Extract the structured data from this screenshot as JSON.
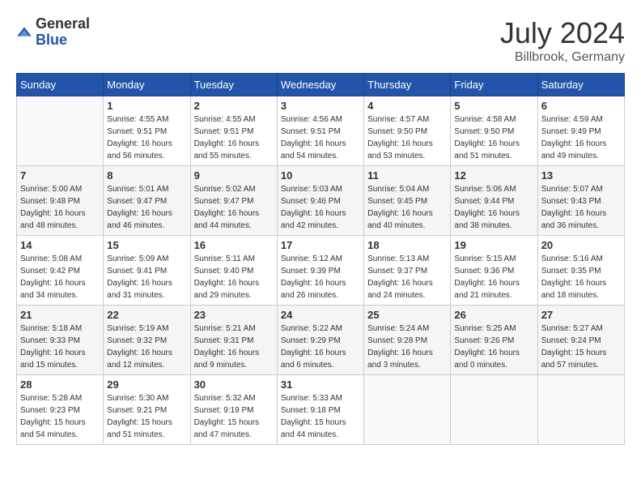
{
  "logo": {
    "general": "General",
    "blue": "Blue"
  },
  "title": "July 2024",
  "subtitle": "Billbrook, Germany",
  "days_of_week": [
    "Sunday",
    "Monday",
    "Tuesday",
    "Wednesday",
    "Thursday",
    "Friday",
    "Saturday"
  ],
  "weeks": [
    [
      {
        "day": "",
        "info": ""
      },
      {
        "day": "1",
        "info": "Sunrise: 4:55 AM\nSunset: 9:51 PM\nDaylight: 16 hours and 56 minutes."
      },
      {
        "day": "2",
        "info": "Sunrise: 4:55 AM\nSunset: 9:51 PM\nDaylight: 16 hours and 55 minutes."
      },
      {
        "day": "3",
        "info": "Sunrise: 4:56 AM\nSunset: 9:51 PM\nDaylight: 16 hours and 54 minutes."
      },
      {
        "day": "4",
        "info": "Sunrise: 4:57 AM\nSunset: 9:50 PM\nDaylight: 16 hours and 53 minutes."
      },
      {
        "day": "5",
        "info": "Sunrise: 4:58 AM\nSunset: 9:50 PM\nDaylight: 16 hours and 51 minutes."
      },
      {
        "day": "6",
        "info": "Sunrise: 4:59 AM\nSunset: 9:49 PM\nDaylight: 16 hours and 49 minutes."
      }
    ],
    [
      {
        "day": "7",
        "info": "Sunrise: 5:00 AM\nSunset: 9:48 PM\nDaylight: 16 hours and 48 minutes."
      },
      {
        "day": "8",
        "info": "Sunrise: 5:01 AM\nSunset: 9:47 PM\nDaylight: 16 hours and 46 minutes."
      },
      {
        "day": "9",
        "info": "Sunrise: 5:02 AM\nSunset: 9:47 PM\nDaylight: 16 hours and 44 minutes."
      },
      {
        "day": "10",
        "info": "Sunrise: 5:03 AM\nSunset: 9:46 PM\nDaylight: 16 hours and 42 minutes."
      },
      {
        "day": "11",
        "info": "Sunrise: 5:04 AM\nSunset: 9:45 PM\nDaylight: 16 hours and 40 minutes."
      },
      {
        "day": "12",
        "info": "Sunrise: 5:06 AM\nSunset: 9:44 PM\nDaylight: 16 hours and 38 minutes."
      },
      {
        "day": "13",
        "info": "Sunrise: 5:07 AM\nSunset: 9:43 PM\nDaylight: 16 hours and 36 minutes."
      }
    ],
    [
      {
        "day": "14",
        "info": "Sunrise: 5:08 AM\nSunset: 9:42 PM\nDaylight: 16 hours and 34 minutes."
      },
      {
        "day": "15",
        "info": "Sunrise: 5:09 AM\nSunset: 9:41 PM\nDaylight: 16 hours and 31 minutes."
      },
      {
        "day": "16",
        "info": "Sunrise: 5:11 AM\nSunset: 9:40 PM\nDaylight: 16 hours and 29 minutes."
      },
      {
        "day": "17",
        "info": "Sunrise: 5:12 AM\nSunset: 9:39 PM\nDaylight: 16 hours and 26 minutes."
      },
      {
        "day": "18",
        "info": "Sunrise: 5:13 AM\nSunset: 9:37 PM\nDaylight: 16 hours and 24 minutes."
      },
      {
        "day": "19",
        "info": "Sunrise: 5:15 AM\nSunset: 9:36 PM\nDaylight: 16 hours and 21 minutes."
      },
      {
        "day": "20",
        "info": "Sunrise: 5:16 AM\nSunset: 9:35 PM\nDaylight: 16 hours and 18 minutes."
      }
    ],
    [
      {
        "day": "21",
        "info": "Sunrise: 5:18 AM\nSunset: 9:33 PM\nDaylight: 16 hours and 15 minutes."
      },
      {
        "day": "22",
        "info": "Sunrise: 5:19 AM\nSunset: 9:32 PM\nDaylight: 16 hours and 12 minutes."
      },
      {
        "day": "23",
        "info": "Sunrise: 5:21 AM\nSunset: 9:31 PM\nDaylight: 16 hours and 9 minutes."
      },
      {
        "day": "24",
        "info": "Sunrise: 5:22 AM\nSunset: 9:29 PM\nDaylight: 16 hours and 6 minutes."
      },
      {
        "day": "25",
        "info": "Sunrise: 5:24 AM\nSunset: 9:28 PM\nDaylight: 16 hours and 3 minutes."
      },
      {
        "day": "26",
        "info": "Sunrise: 5:25 AM\nSunset: 9:26 PM\nDaylight: 16 hours and 0 minutes."
      },
      {
        "day": "27",
        "info": "Sunrise: 5:27 AM\nSunset: 9:24 PM\nDaylight: 15 hours and 57 minutes."
      }
    ],
    [
      {
        "day": "28",
        "info": "Sunrise: 5:28 AM\nSunset: 9:23 PM\nDaylight: 15 hours and 54 minutes."
      },
      {
        "day": "29",
        "info": "Sunrise: 5:30 AM\nSunset: 9:21 PM\nDaylight: 15 hours and 51 minutes."
      },
      {
        "day": "30",
        "info": "Sunrise: 5:32 AM\nSunset: 9:19 PM\nDaylight: 15 hours and 47 minutes."
      },
      {
        "day": "31",
        "info": "Sunrise: 5:33 AM\nSunset: 9:18 PM\nDaylight: 15 hours and 44 minutes."
      },
      {
        "day": "",
        "info": ""
      },
      {
        "day": "",
        "info": ""
      },
      {
        "day": "",
        "info": ""
      }
    ]
  ]
}
